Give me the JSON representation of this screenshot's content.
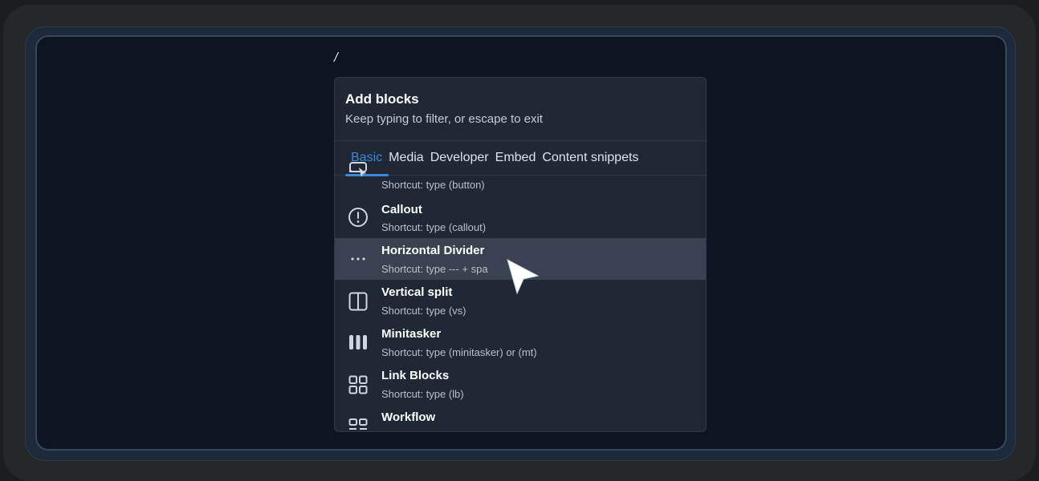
{
  "editor": {
    "slash_text": "/"
  },
  "popup": {
    "title": "Add blocks",
    "subtitle": "Keep typing to filter, or escape to exit",
    "tabs": [
      {
        "label": "Basic",
        "active": true
      },
      {
        "label": "Media",
        "active": false
      },
      {
        "label": "Developer",
        "active": false
      },
      {
        "label": "Embed",
        "active": false
      },
      {
        "label": "Content snippets",
        "active": false
      }
    ],
    "items": [
      {
        "title": "",
        "shortcut": "Shortcut: type (button)",
        "icon": "button-icon"
      },
      {
        "title": "Callout",
        "shortcut": "Shortcut: type (callout)",
        "icon": "exclamation-circle-icon"
      },
      {
        "title": "Horizontal Divider",
        "shortcut": "Shortcut: type --- + spa",
        "icon": "ellipsis-icon",
        "selected": true
      },
      {
        "title": "Vertical split",
        "shortcut": "Shortcut: type (vs)",
        "icon": "split-column-icon"
      },
      {
        "title": "Minitasker",
        "shortcut": "Shortcut: type (minitasker) or (mt)",
        "icon": "three-bars-icon"
      },
      {
        "title": "Link Blocks",
        "shortcut": "Shortcut: type (lb)",
        "icon": "grid-icon"
      },
      {
        "title": "Workflow",
        "shortcut": "",
        "icon": "workflow-icon"
      }
    ]
  },
  "colors": {
    "accent": "#3f86d4",
    "popup_bg": "#1f2835",
    "selected_bg": "#384251",
    "screen_bg": "#0d1520"
  }
}
